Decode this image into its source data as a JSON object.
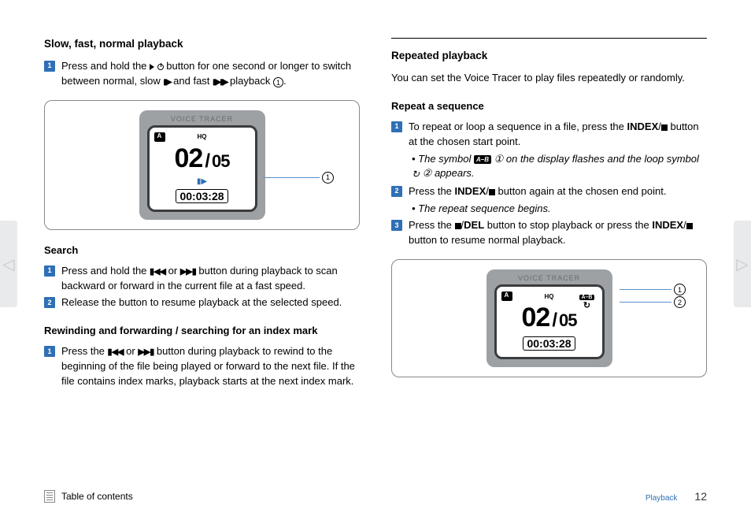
{
  "left": {
    "h_slow": "Slow, fast, normal playback",
    "step1": "Press and hold the  ▶ ⏻  button for one second or longer to switch between normal, slow  ▮▶  and fast  ▮▶▮▶  playback ①.",
    "device": {
      "brand": "VOICE TRACER",
      "hq": "HQ",
      "folder": "A",
      "num": "02",
      "total": "05",
      "time": "00:03:28",
      "callout1": "1"
    },
    "h_search": "Search",
    "search1": "Press and hold the ◀◀ or ▶▶ button during playback to scan backward or forward in the current file at a fast speed.",
    "search2": "Release the button to resume playback at the selected speed.",
    "h_rewind": "Rewinding and forwarding / searching for an index mark",
    "rewind1": "Press the ◀◀ or ▶▶ button during playback to rewind to the beginning of the file being played or forward to the next file. If the file contains index marks, playback starts at the next index mark."
  },
  "right": {
    "h_repeated": "Repeated playback",
    "intro": "You can set the Voice Tracer to play files repeatedly or randomly.",
    "h_repeatseq": "Repeat a sequence",
    "rs1_a": "To repeat or loop a sequence in a file, press the ",
    "rs1_index": "INDEX",
    "rs1_b": "/",
    "rs1_c": " button at the chosen start point.",
    "rs1_sub1_a": "The symbol ",
    "rs1_sub1_ab": "A–B",
    "rs1_sub1_b": " ① on the display flashes and the loop symbol ",
    "rs1_sub1_loop_c": " ② appears.",
    "rs2_a": "Press the ",
    "rs2_b": " button again at the chosen end point.",
    "rs2_sub": "The repeat sequence begins.",
    "rs3_a": "Press the ",
    "rs3_del": "DEL",
    "rs3_b": " button to stop playback or press the ",
    "rs3_c": " button to resume normal playback.",
    "device": {
      "brand": "VOICE TRACER",
      "hq": "HQ",
      "folder": "A",
      "ab": "A–B",
      "num": "02",
      "total": "05",
      "time": "00:03:28",
      "c1": "1",
      "c2": "2"
    }
  },
  "footer": {
    "toc": "Table of contents",
    "section": "Playback",
    "page": "12"
  }
}
